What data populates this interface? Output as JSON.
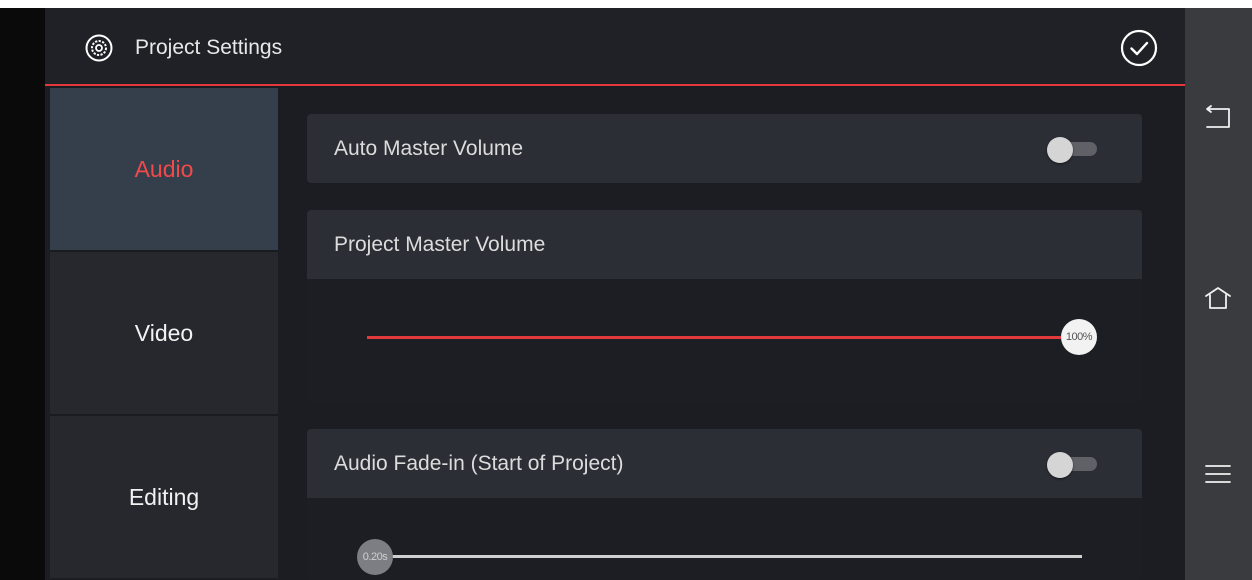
{
  "header": {
    "title": "Project Settings",
    "settings_icon": "settings-icon",
    "confirm_icon": "check-circle-icon"
  },
  "sidebar": {
    "items": [
      {
        "label": "Audio",
        "active": true
      },
      {
        "label": "Video",
        "active": false
      },
      {
        "label": "Editing",
        "active": false
      }
    ]
  },
  "audio": {
    "auto_master_volume": {
      "label": "Auto Master Volume",
      "enabled": false
    },
    "project_master_volume": {
      "label": "Project Master Volume",
      "value_label": "100%",
      "value": 1.0
    },
    "audio_fade_in": {
      "label": "Audio Fade-in (Start of Project)",
      "enabled": false,
      "value_label": "0.20s",
      "value": 0.0
    }
  },
  "navbar": {
    "back_icon": "back-icon",
    "home_icon": "home-icon",
    "menu_icon": "menu-icon"
  },
  "colors": {
    "accent": "#e2393d",
    "active_tab_bg": "#343f4b",
    "background": "#1c1d22"
  }
}
